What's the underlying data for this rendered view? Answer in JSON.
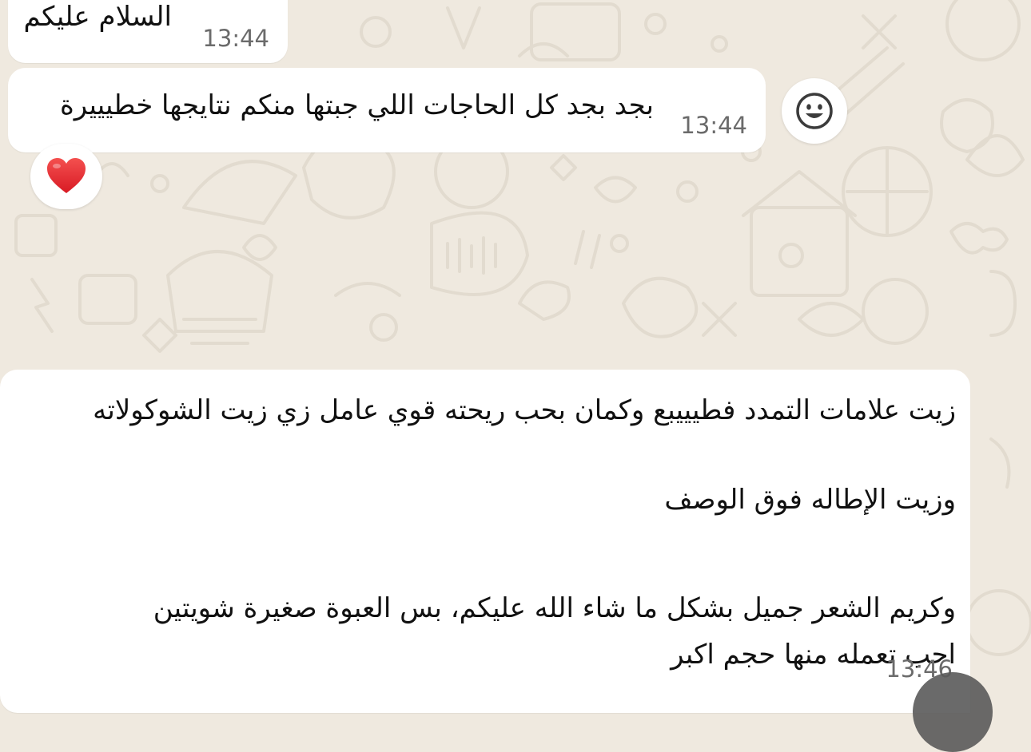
{
  "chat": {
    "messages": [
      {
        "lines": [
          "السلام عليكم"
        ],
        "time": "13:44"
      },
      {
        "lines": [
          "بجد بجد كل الحاجات اللي جبتها منكم نتايجها خطيييرة"
        ],
        "time": "13:44",
        "reaction": "red-heart"
      },
      {
        "lines": [
          "زيت علامات التمدد فطيييبع وكمان بحب ريحته قوي عامل زي زيت الشوكولاته",
          "وزيت الإطاله فوق الوصف",
          "وكريم الشعر جميل بشكل ما شاء الله عليكم، بس العبوة صغيرة شويتين",
          "احب تعمله منها حجم اكبر"
        ],
        "time": "13:46"
      }
    ]
  },
  "icons": {
    "react_button": "smiley-face-icon",
    "reaction": "red-heart-icon"
  },
  "colors": {
    "wallpaper": "#efe9df",
    "bubble": "#ffffff",
    "heart": "#e8222e",
    "time_text": "#6b6b6b"
  }
}
